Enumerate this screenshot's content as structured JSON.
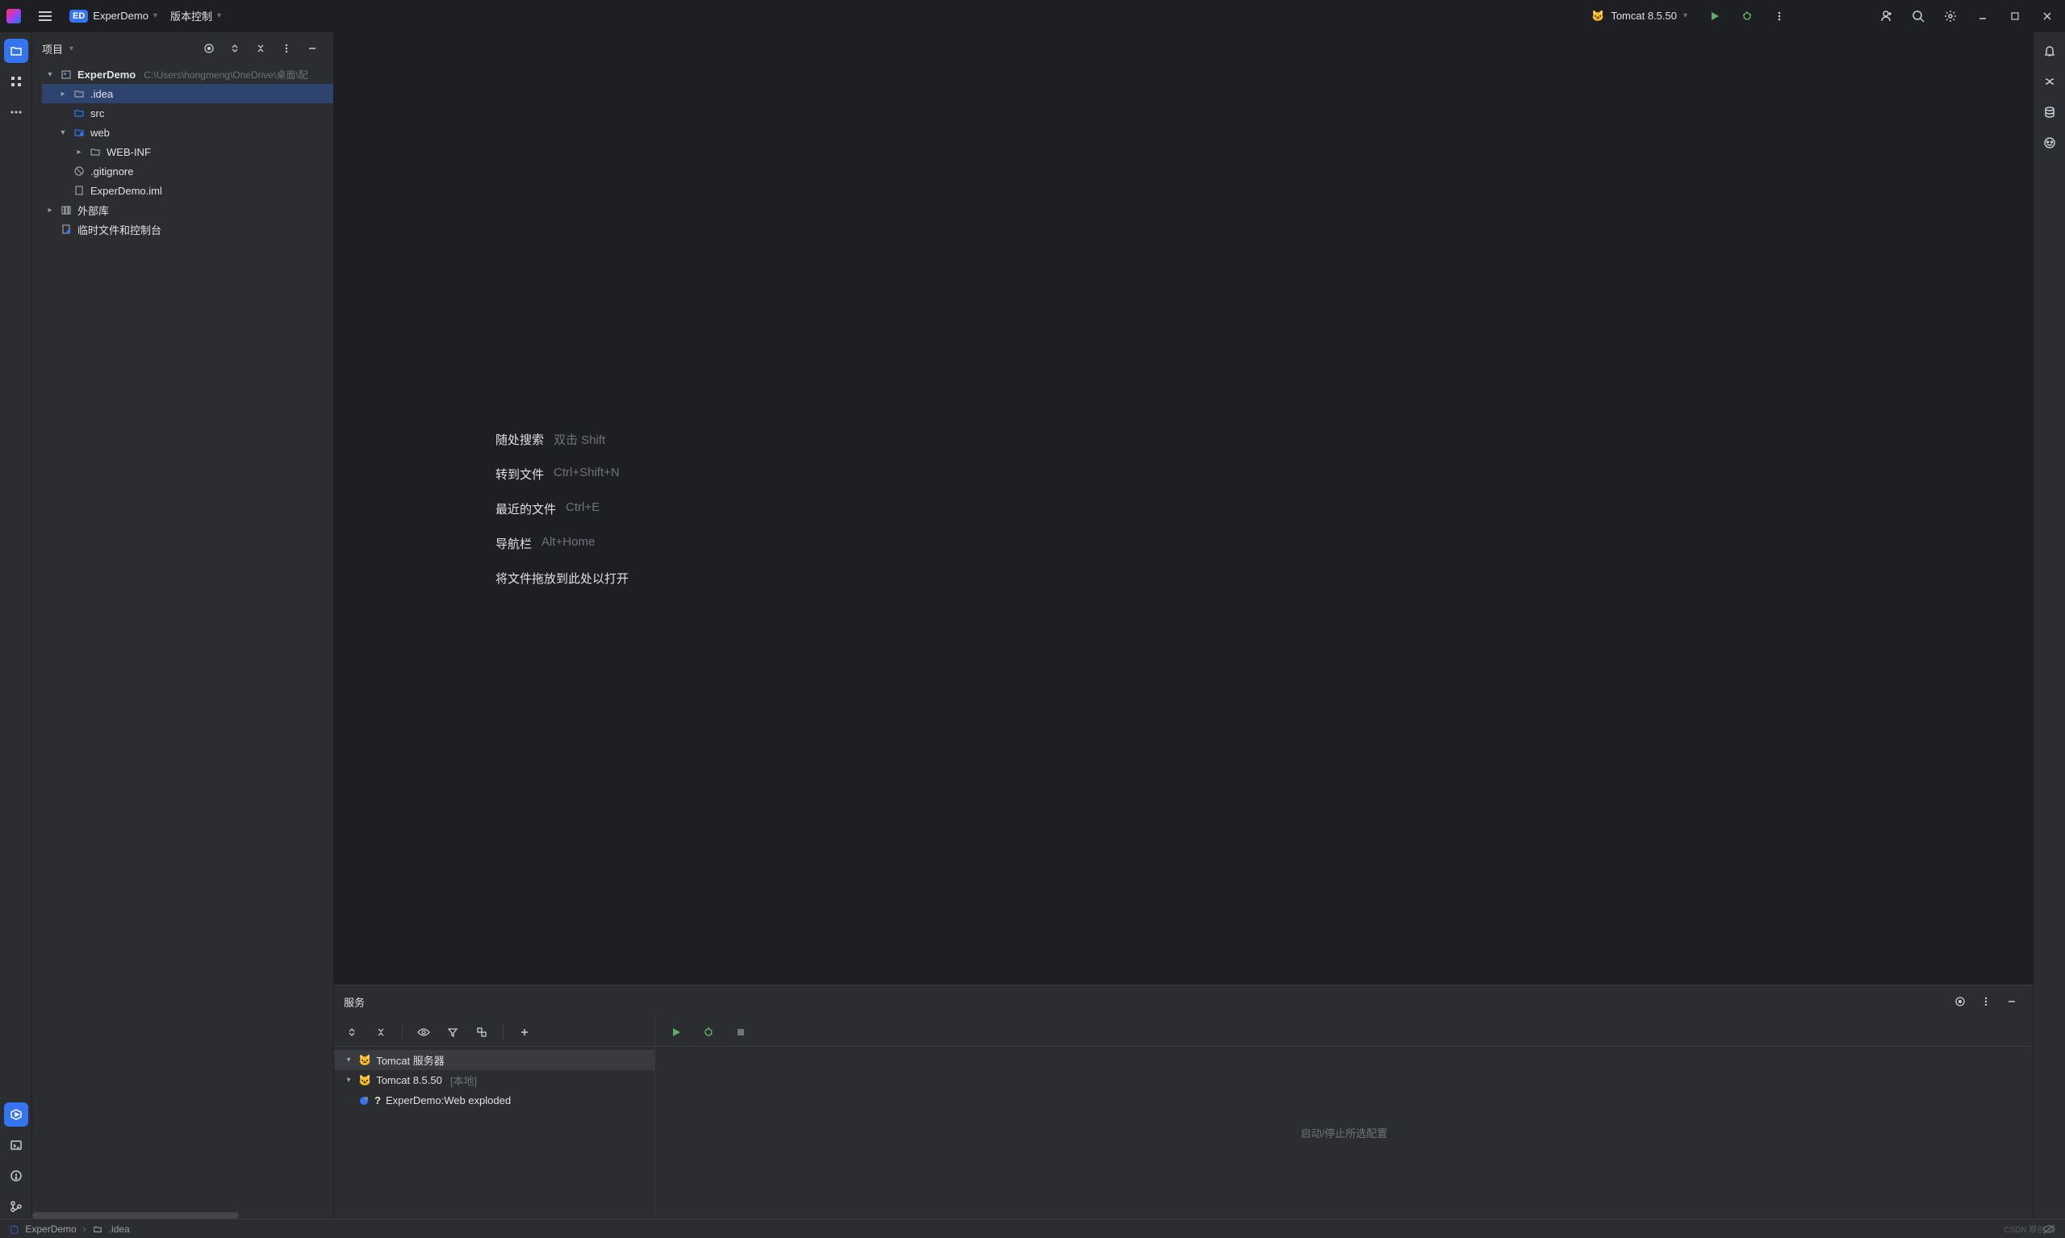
{
  "titlebar": {
    "project_name": "ExperDemo",
    "project_badge": "ED",
    "vcs_menu": "版本控制",
    "run_config": "Tomcat 8.5.50"
  },
  "project_panel": {
    "title": "项目",
    "root": {
      "name": "ExperDemo",
      "path": "C:\\Users\\hongmeng\\OneDrive\\桌面\\配"
    },
    "nodes": {
      "idea": ".idea",
      "src": "src",
      "web": "web",
      "webinf": "WEB-INF",
      "gitignore": ".gitignore",
      "iml": "ExperDemo.iml",
      "external_libs": "外部库",
      "scratches": "临时文件和控制台"
    }
  },
  "editor_hints": {
    "search_everywhere": {
      "label": "随处搜索",
      "key": "双击 Shift"
    },
    "goto_file": {
      "label": "转到文件",
      "key": "Ctrl+Shift+N"
    },
    "recent_files": {
      "label": "最近的文件",
      "key": "Ctrl+E"
    },
    "nav_bar": {
      "label": "导航栏",
      "key": "Alt+Home"
    },
    "drop_hint": "将文件拖放到此处以打开"
  },
  "services": {
    "title": "服务",
    "tomcat_server": "Tomcat 服务器",
    "tomcat_version": "Tomcat 8.5.50",
    "tomcat_local": "[本地]",
    "artifact": "ExperDemo:Web exploded",
    "placeholder": "启动/停止所选配置"
  },
  "statusbar": {
    "breadcrumb1": "ExperDemo",
    "breadcrumb2": ".idea"
  },
  "watermark": "CSDN 原创 鸿"
}
